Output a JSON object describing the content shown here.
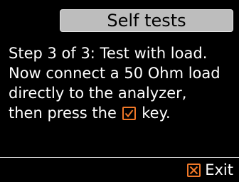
{
  "header": {
    "title": "Self tests"
  },
  "instructions": {
    "line1": "Step 3 of 3: Test with load.",
    "line2": "Now connect a 50 Ohm load",
    "line3": "directly to the analyzer,",
    "line4_before": "then press the ",
    "line4_icon": "check-icon",
    "line4_after": " key."
  },
  "footer": {
    "exit_icon": "x-icon",
    "exit_label": "Exit"
  },
  "colors": {
    "background": "#000000",
    "title_bar": "#bdbdbd",
    "accent": "#f07828",
    "text": "#ffffff"
  }
}
